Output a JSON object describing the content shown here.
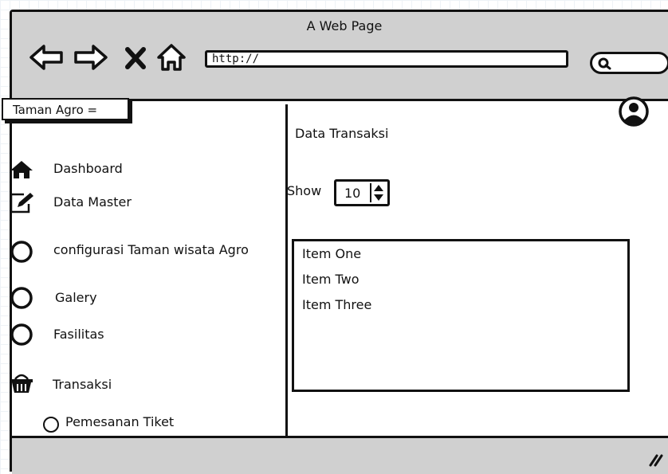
{
  "window": {
    "title": "A Web Page"
  },
  "toolbar": {
    "url": "http://"
  },
  "sidebar": {
    "brand": "Taman Agro =",
    "items": [
      {
        "label": "Dashboard",
        "icon": "home-icon"
      },
      {
        "label": "Data Master",
        "icon": "edit-icon"
      },
      {
        "label": "configurasi Taman wisata Agro",
        "icon": "circle-icon"
      },
      {
        "label": "Galery",
        "icon": "circle-icon"
      },
      {
        "label": "Fasilitas",
        "icon": "circle-icon"
      },
      {
        "label": "Transaksi",
        "icon": "basket-icon"
      },
      {
        "label": "Pemesanan Tiket",
        "icon": "circle-icon"
      }
    ]
  },
  "main": {
    "title": "Data Transaksi",
    "show_label": "Show",
    "show_value": "10",
    "list": [
      "Item One",
      "Item Two",
      "Item Three"
    ]
  }
}
